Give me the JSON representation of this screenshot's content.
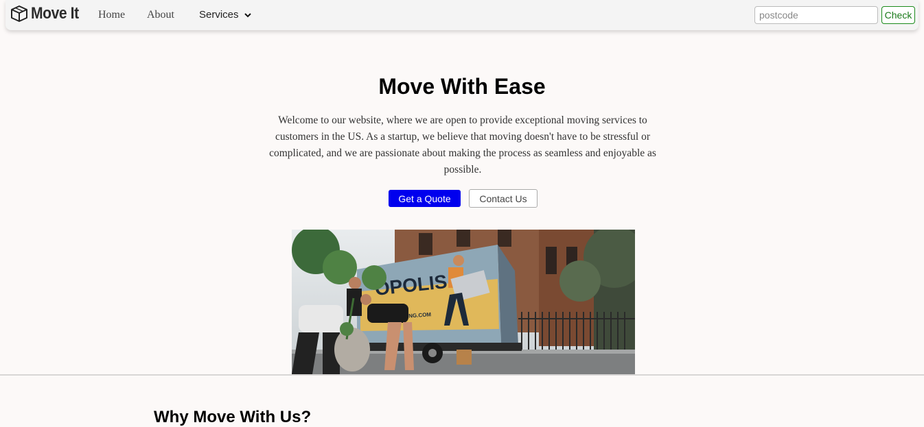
{
  "nav": {
    "brand": "Move It",
    "brand_icon": "box-icon",
    "links": [
      "Home",
      "About"
    ],
    "services_label": "Services",
    "services_icon": "chevron-down-icon",
    "postcode_placeholder": "postcode",
    "postcode_value": "",
    "check_label": "Check",
    "check_color": "#1a7a1a"
  },
  "hero": {
    "title": "Move With Ease",
    "text": "Welcome to our website, where we are open to provide exceptional moving services to customers in the US. As a startup, we believe that moving doesn't have to be stressful or complicated, and we are passionate about making the process as seamless and enjoyable as possible.",
    "primary_button": "Get a Quote",
    "primary_color": "#0000ee",
    "secondary_button": "Contact Us",
    "image": {
      "truck_text": "OPOLIS",
      "truck_subtext": "MOVING.COM"
    }
  },
  "why": {
    "title": "Why Move With Us?"
  }
}
